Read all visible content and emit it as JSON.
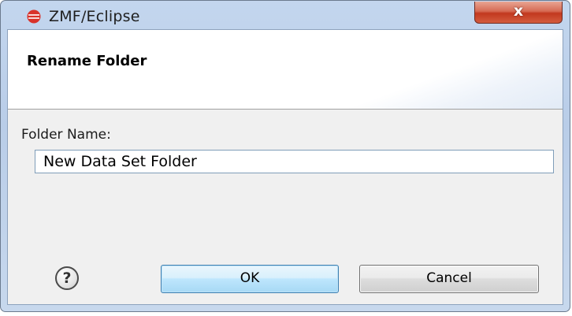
{
  "window": {
    "title": "ZMF/Eclipse",
    "close_label": "x"
  },
  "banner": {
    "title": "Rename Folder"
  },
  "form": {
    "folder_name_label": "Folder Name:",
    "folder_name_value": "New Data Set Folder"
  },
  "buttons": {
    "help_symbol": "?",
    "ok_label": "OK",
    "cancel_label": "Cancel"
  },
  "colors": {
    "close_button": "#c2381f",
    "ok_button_border": "#3c7fb1",
    "frame": "#b9cde8",
    "app_icon": "#d9322a"
  },
  "icons": {
    "app": "eclipse-icon",
    "close": "close-icon",
    "help": "help-icon"
  }
}
